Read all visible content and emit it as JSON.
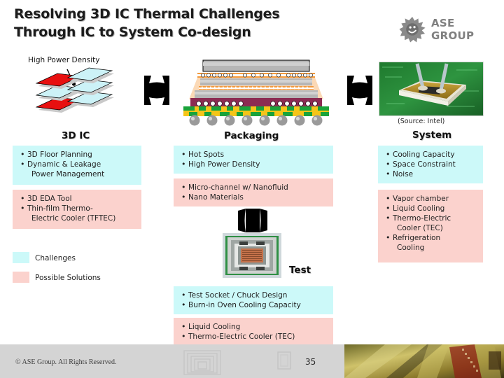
{
  "slide": {
    "title_line1": "Resolving 3D IC Thermal Challenges",
    "title_line2": "Through IC to System Co-design",
    "logo_text": "ASE GROUP",
    "logo_icon": "ase-sun-smiley-logo"
  },
  "columns": {
    "ic": {
      "caption": "3D IC",
      "annotation": "High Power Density",
      "diagram": "3d-ic-stacked-die-diagram",
      "challenges": [
        "3D Floor Planning",
        "Dynamic & Leakage",
        "Power Management"
      ],
      "solutions": [
        "3D EDA Tool",
        "Thin-film Thermo-",
        "Electric Cooler (TFTEC)"
      ]
    },
    "packaging": {
      "caption": "Packaging",
      "diagram": "flip-chip-package-cross-section",
      "challenges": [
        "Hot Spots",
        "High Power Density"
      ],
      "solutions": [
        "Micro-channel w/ Nanofluid",
        "Nano Materials"
      ]
    },
    "system": {
      "caption": "System",
      "source": "(Source: Intel)",
      "photo": "system-heatsink-heatpipe-photo",
      "challenges": [
        "Cooling Capacity",
        "Space Constraint",
        "Noise"
      ],
      "solutions": [
        "Vapor chamber",
        "Liquid Cooling",
        "Thermo-Electric",
        "Cooler (TEC)",
        "Refrigeration",
        "Cooling"
      ]
    },
    "test": {
      "caption": "Test",
      "photo": "test-socket-photo",
      "challenges": [
        "Test Socket / Chuck Design",
        "Burn-in Oven Cooling Capacity"
      ],
      "solutions": [
        "Liquid Cooling",
        "Thermo-Electric Cooler (TEC)"
      ]
    }
  },
  "legend": {
    "challenges_label": "Challenges",
    "solutions_label": "Possible Solutions"
  },
  "footer": {
    "copyright": "© ASE Group. All Rights Reserved.",
    "page_number": "35"
  },
  "colors": {
    "challenge_bg": "#ccf9f9",
    "solution_bg": "#fbd2cd",
    "hotspot_red": "#e81010",
    "die_blue": "#ccf2f7",
    "footer_bg": "#d4d4d4"
  }
}
